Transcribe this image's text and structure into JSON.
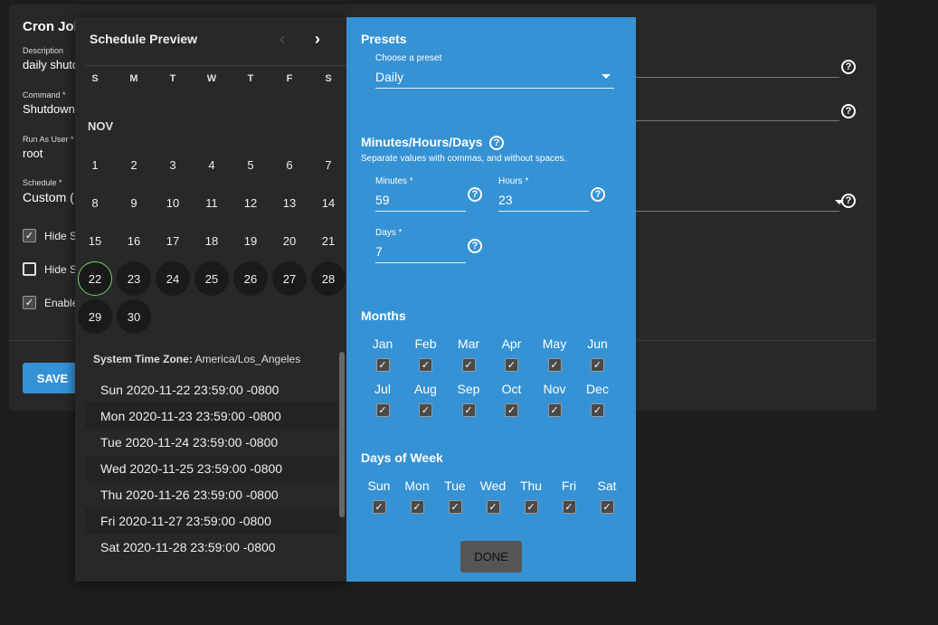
{
  "form": {
    "title": "Cron Job",
    "description": {
      "label": "Description",
      "value": "daily shutd"
    },
    "command": {
      "label": "Command *",
      "value": "Shutdown -"
    },
    "run_as": {
      "label": "Run As User *",
      "value": "root"
    },
    "schedule": {
      "label": "Schedule *",
      "value": "Custom ("
    },
    "checks": [
      {
        "label": "Hide S",
        "checked": true
      },
      {
        "label": "Hide S",
        "checked": false
      },
      {
        "label": "Enable",
        "checked": true
      }
    ],
    "save_label": "SAVE"
  },
  "preview": {
    "title": "Schedule Preview",
    "weekdays": [
      "S",
      "M",
      "T",
      "W",
      "T",
      "F",
      "S"
    ],
    "month": "NOV",
    "days": [
      "1",
      "2",
      "3",
      "4",
      "5",
      "6",
      "7",
      "8",
      "9",
      "10",
      "11",
      "12",
      "13",
      "14",
      "15",
      "16",
      "17",
      "18",
      "19",
      "20",
      "21",
      "22",
      "23",
      "24",
      "25",
      "26",
      "27",
      "28",
      "29",
      "30"
    ],
    "today": "22",
    "timezone_label": "System Time Zone:",
    "timezone_value": "America/Los_Angeles",
    "runs": [
      "Sun 2020-11-22 23:59:00 -0800",
      "Mon 2020-11-23 23:59:00 -0800",
      "Tue 2020-11-24 23:59:00 -0800",
      "Wed 2020-11-25 23:59:00 -0800",
      "Thu 2020-11-26 23:59:00 -0800",
      "Fri 2020-11-27 23:59:00 -0800",
      "Sat 2020-11-28 23:59:00 -0800"
    ]
  },
  "config": {
    "presets": {
      "title": "Presets",
      "label": "Choose a preset",
      "value": "Daily"
    },
    "mhd": {
      "title": "Minutes/Hours/Days",
      "hint": "Separate values with commas, and without spaces.",
      "minutes": {
        "label": "Minutes *",
        "value": "59"
      },
      "hours": {
        "label": "Hours *",
        "value": "23"
      },
      "days": {
        "label": "Days *",
        "value": "7"
      }
    },
    "months": {
      "title": "Months",
      "items": [
        "Jan",
        "Feb",
        "Mar",
        "Apr",
        "May",
        "Jun",
        "Jul",
        "Aug",
        "Sep",
        "Oct",
        "Nov",
        "Dec"
      ]
    },
    "dow": {
      "title": "Days of Week",
      "items": [
        "Sun",
        "Mon",
        "Tue",
        "Wed",
        "Thu",
        "Fri",
        "Sat"
      ]
    },
    "done_label": "DONE"
  },
  "colors": {
    "accent": "#3592d4",
    "panel": "#282828",
    "today_ring": "#6ad16a"
  }
}
